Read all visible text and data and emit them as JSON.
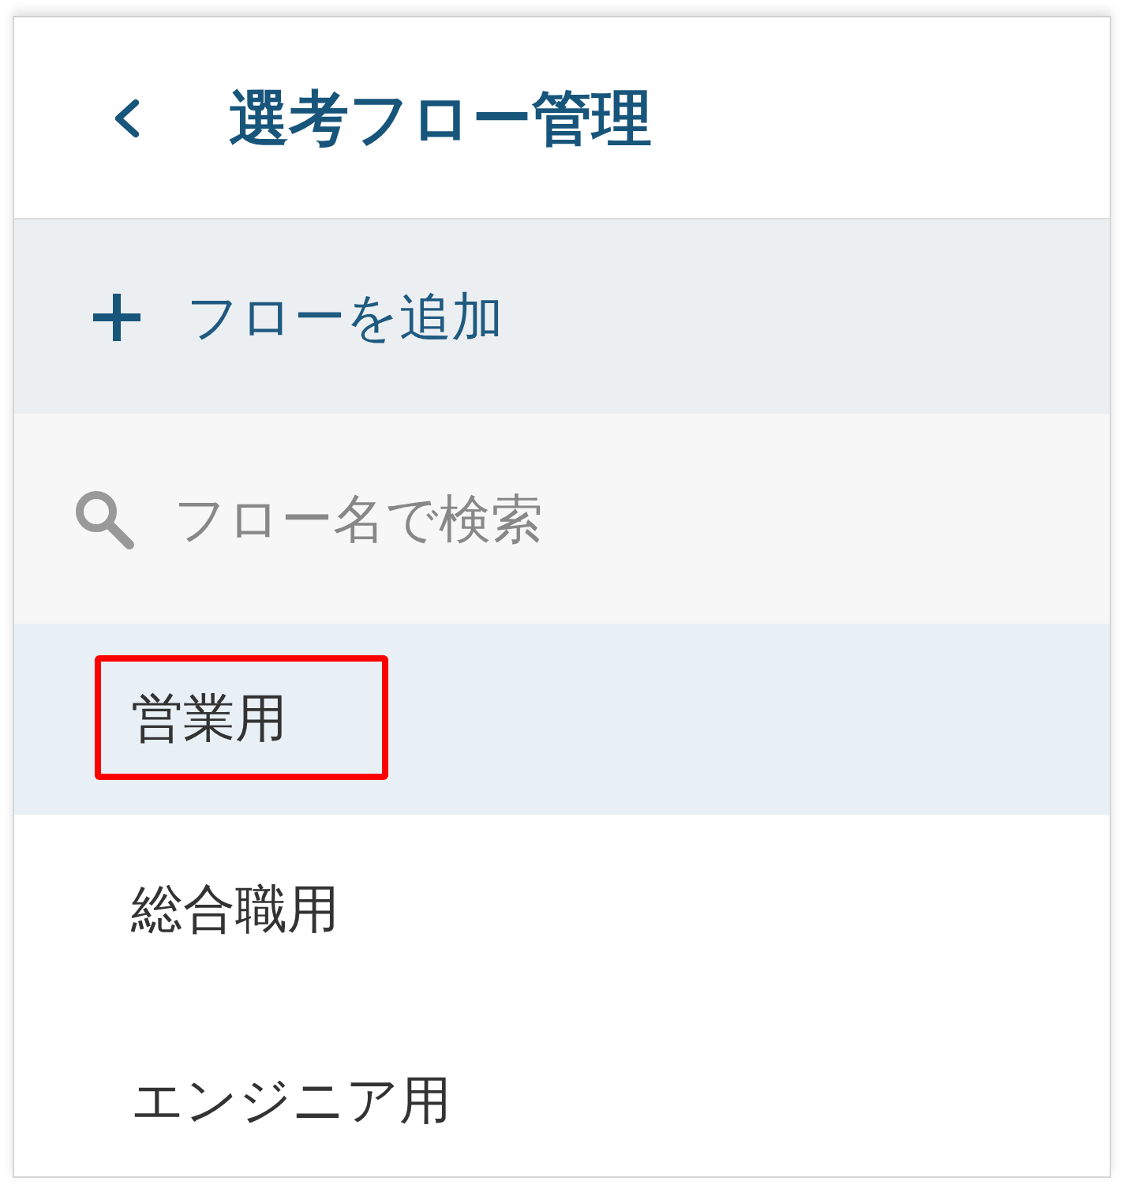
{
  "header": {
    "title": "選考フロー管理"
  },
  "add_button": {
    "label": "フローを追加"
  },
  "search": {
    "placeholder": "フロー名で検索"
  },
  "flows": [
    {
      "name": "営業用",
      "selected": true,
      "highlighted": true
    },
    {
      "name": "総合職用",
      "selected": false,
      "highlighted": false
    },
    {
      "name": "エンジニア用",
      "selected": false,
      "highlighted": false
    }
  ]
}
